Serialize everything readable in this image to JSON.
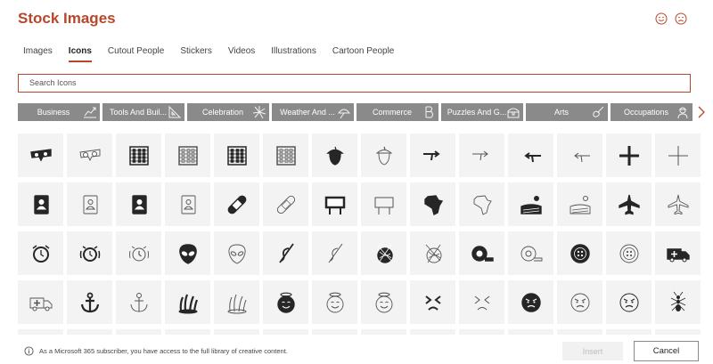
{
  "dialog": {
    "title": "Stock Images"
  },
  "tabs": [
    {
      "label": "Images",
      "active": false
    },
    {
      "label": "Icons",
      "active": true
    },
    {
      "label": "Cutout People",
      "active": false
    },
    {
      "label": "Stickers",
      "active": false
    },
    {
      "label": "Videos",
      "active": false
    },
    {
      "label": "Illustrations",
      "active": false
    },
    {
      "label": "Cartoon People",
      "active": false
    }
  ],
  "search": {
    "placeholder": "Search Icons"
  },
  "categories": [
    {
      "label": "Business",
      "icon": "chart-trend-icon"
    },
    {
      "label": "Tools And Buil...",
      "icon": "ruler-triangle-icon"
    },
    {
      "label": "Celebration",
      "icon": "fireworks-icon"
    },
    {
      "label": "Weather And ...",
      "icon": "umbrella-icon"
    },
    {
      "label": "Commerce",
      "icon": "bitcoin-icon"
    },
    {
      "label": "Puzzles And G...",
      "icon": "treasure-chest-icon"
    },
    {
      "label": "Arts",
      "icon": "guitar-icon"
    },
    {
      "label": "Occupations",
      "icon": "worker-icon"
    }
  ],
  "icons": [
    [
      "3d-glasses-icon",
      "3d-glasses-outline-icon",
      "abacus-icon",
      "abacus-outline-icon",
      "abacus-frame-icon",
      "abacus-frame-outline-icon",
      "acorn-icon",
      "acorn-outline-icon",
      "curve-arrow-right-icon",
      "curve-arrow-right-outline-icon",
      "curve-arrow-left-icon",
      "curve-arrow-left-outline-icon",
      "add-icon",
      "add-outline-icon"
    ],
    [
      "address-book-icon",
      "address-book-outline-icon",
      "address-book-dark-icon",
      "address-book-light-icon",
      "adhesive-bandage-icon",
      "adhesive-bandage-outline-icon",
      "billboard-icon",
      "billboard-outline-icon",
      "africa-icon",
      "africa-outline-icon",
      "farm-field-icon",
      "farm-field-outline-icon",
      "airplane-icon",
      "airplane-outline-icon"
    ],
    [
      "alarm-clock-icon",
      "alarm-ringing-icon",
      "alarm-ringing-outline-icon",
      "alien-icon",
      "alien-outline-icon",
      "knitting-needle-icon",
      "knitting-needle-outline-icon",
      "yarn-ball-icon",
      "yarn-ball-outline-icon",
      "tape-measure-icon",
      "tape-measure-outline-icon",
      "button-icon",
      "button-outline-icon",
      "ambulance-icon"
    ],
    [
      "ambulance-outline-icon",
      "anchor-icon",
      "anchor-outline-icon",
      "coral-icon",
      "coral-outline-icon",
      "angel-face-icon",
      "angel-face-outline-icon",
      "angel-face-light-icon",
      "angry-squint-icon",
      "angry-squint-outline-icon",
      "angry-face-icon",
      "angry-face-outline-icon",
      "angry-frown-icon",
      "ant-icon"
    ]
  ],
  "footer": {
    "info": "As a Microsoft 365 subscriber, you have access to the full library of creative content.",
    "insert_label": "Insert",
    "cancel_label": "Cancel"
  },
  "colors": {
    "accent": "#b7472a",
    "tile": "#f3f3f3",
    "category": "#8a8a8a"
  }
}
